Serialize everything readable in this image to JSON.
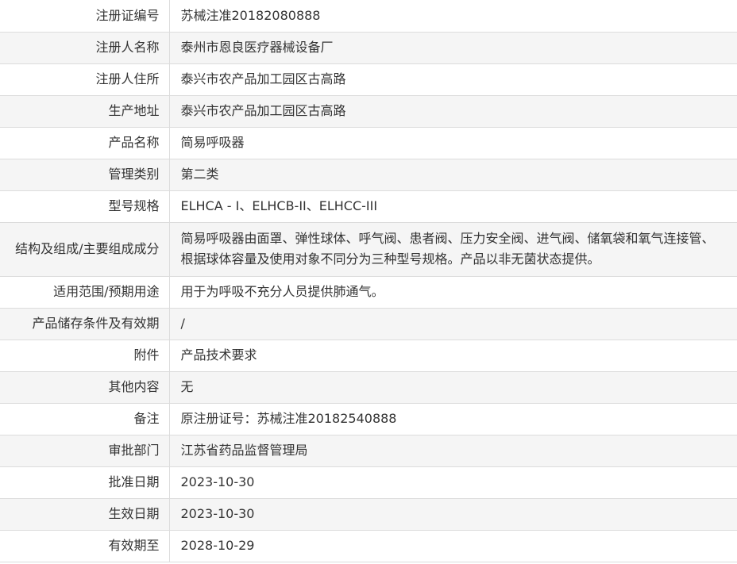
{
  "rows": [
    {
      "label": "注册证编号",
      "value": "苏械注准20182080888"
    },
    {
      "label": "注册人名称",
      "value": "泰州市恩良医疗器械设备厂"
    },
    {
      "label": "注册人住所",
      "value": "泰兴市农产品加工园区古高路"
    },
    {
      "label": "生产地址",
      "value": "泰兴市农产品加工园区古高路"
    },
    {
      "label": "产品名称",
      "value": "简易呼吸器"
    },
    {
      "label": "管理类别",
      "value": "第二类"
    },
    {
      "label": "型号规格",
      "value": "ELHCA - I、ELHCB-II、ELHCC-III"
    },
    {
      "label": "结构及组成/主要组成成分",
      "value_line1": "简易呼吸器由面罩、弹性球体、呼气阀、患者阀、压力安全阀、进气阀、储氧袋和氧气连接管、",
      "value_line2": "根据球体容量及使用对象不同分为三种型号规格。产品以非无菌状态提供。"
    },
    {
      "label": "适用范围/预期用途",
      "value": "用于为呼吸不充分人员提供肺通气。"
    },
    {
      "label": "产品储存条件及有效期",
      "value": "/"
    },
    {
      "label": "附件",
      "value": "产品技术要求"
    },
    {
      "label": "其他内容",
      "value": "无"
    },
    {
      "label": "备注",
      "value": "原注册证号：苏械注准20182540888"
    },
    {
      "label": "审批部门",
      "value": "江苏省药品监督管理局"
    },
    {
      "label": "批准日期",
      "value": "2023-10-30"
    },
    {
      "label": "生效日期",
      "value": "2023-10-30"
    },
    {
      "label": "有效期至",
      "value": "2028-10-29"
    }
  ]
}
